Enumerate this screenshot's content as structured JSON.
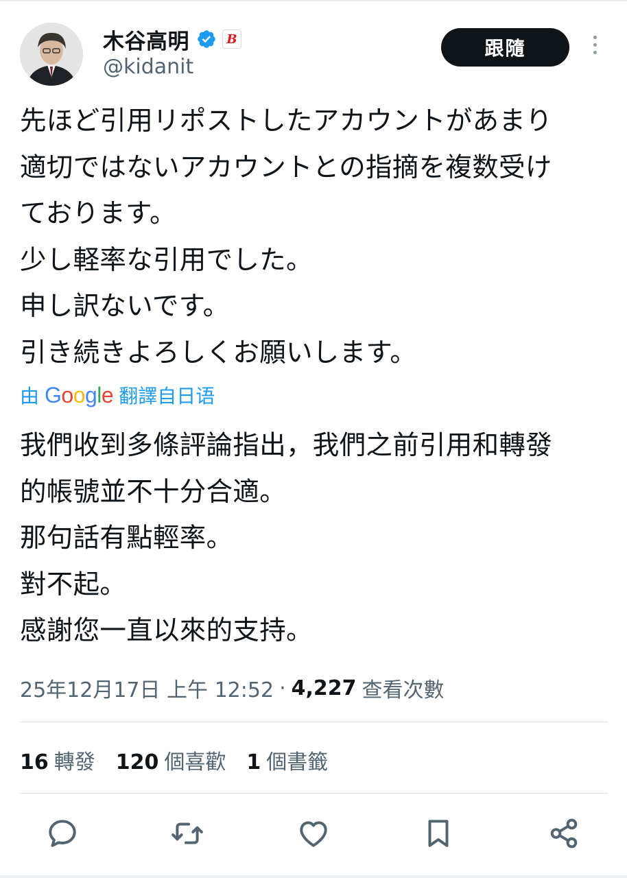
{
  "author": {
    "display_name": "木谷高明",
    "handle": "@kidanit",
    "affiliate_badge": "B",
    "avatar_icon": "profile-photo"
  },
  "follow_label": "跟隨",
  "tweet": {
    "lines": [
      "先ほど引用リポストしたアカウントがあまり",
      "適切ではないアカウントとの指摘を複数受け",
      "ております。",
      "少し軽率な引用でした。",
      "申し訳ないです。",
      "引き続きよろしくお願いします。"
    ]
  },
  "translation": {
    "prefix": "由",
    "google": "Google",
    "suffix": "翻譯自日语",
    "lines": [
      "我們收到多條評論指出，我們之前引用和轉發",
      "的帳號並不十分合適。",
      "那句話有點輕率。",
      "對不起。",
      "感謝您一直以來的支持。"
    ]
  },
  "meta": {
    "timestamp": "25年12月17日 上午 12:52",
    "separator": "·",
    "views_count": "4,227",
    "views_label": "查看次數"
  },
  "stats": {
    "reposts": "16",
    "reposts_label": "轉發",
    "likes": "120",
    "likes_label": "個喜歡",
    "bookmarks": "1",
    "bookmarks_label": "個書籤"
  },
  "colors": {
    "accent": "#1d9bf0",
    "text": "#0f1419",
    "secondary": "#536471",
    "follow_bg": "#0f1419"
  }
}
